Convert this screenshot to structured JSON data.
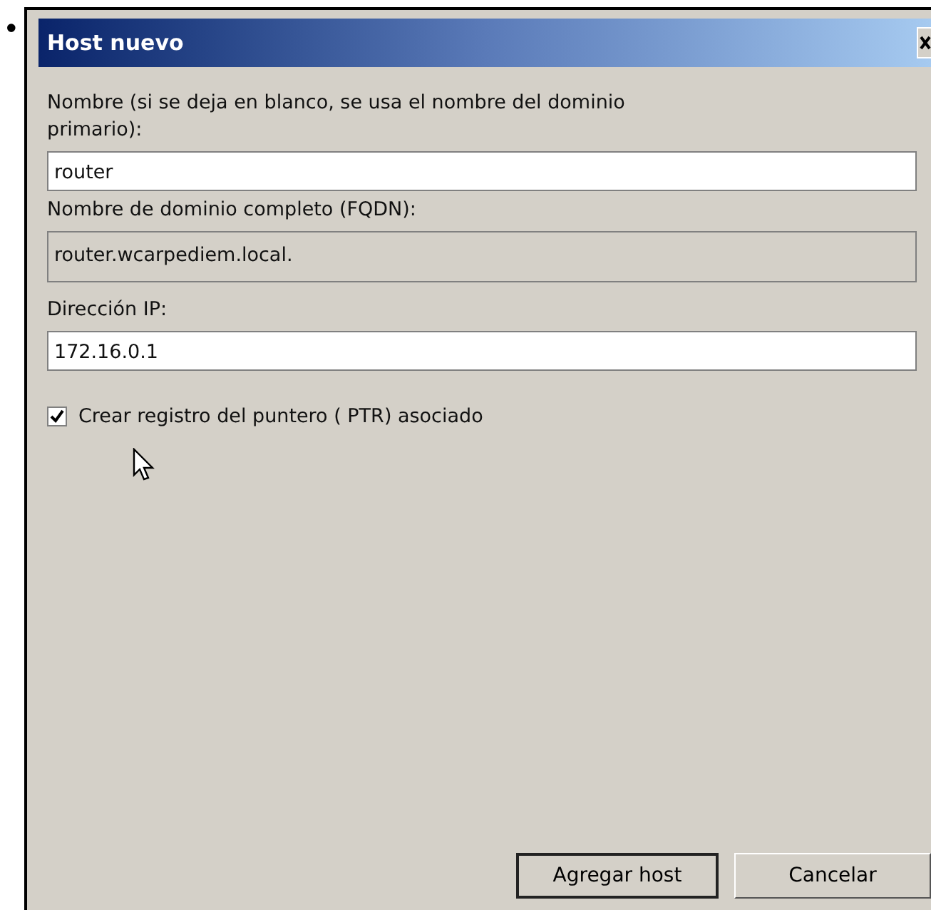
{
  "bullet": "•",
  "window": {
    "title": "Host nuevo"
  },
  "fields": [
    {
      "label": "Nombre (si se deja en blanco, se usa el nombre del dominio primario):",
      "value": "router",
      "disabled": false
    },
    {
      "label": "Nombre de dominio completo (FQDN):",
      "value": "router.wcarpediem.local.",
      "disabled": true
    },
    {
      "label": "Dirección IP:",
      "value": "172.16.0.1",
      "disabled": false
    }
  ],
  "checkbox": {
    "label": "Crear registro del puntero ( PTR) asociado",
    "checked": true
  },
  "buttons": [
    {
      "label": "Agregar host",
      "default": true
    },
    {
      "label": "Cancelar",
      "default": false
    }
  ]
}
